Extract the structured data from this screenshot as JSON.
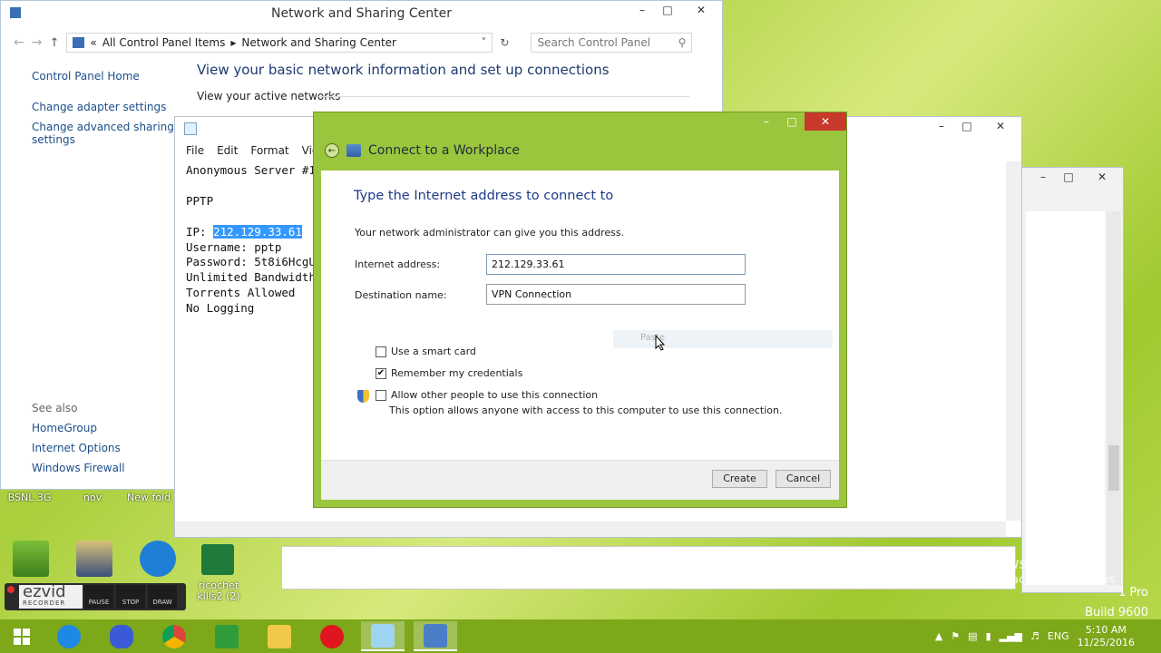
{
  "nsc": {
    "title": "Network and Sharing Center",
    "breadcrumb_root": "All Control Panel Items",
    "breadcrumb_current": "Network and Sharing Center",
    "search_placeholder": "Search Control Panel",
    "side": [
      "Control Panel Home",
      "Change adapter settings",
      "Change advanced sharing settings"
    ],
    "see_also_label": "See also",
    "see_also": [
      "HomeGroup",
      "Internet Options",
      "Windows Firewall"
    ],
    "heading": "View your basic network information and set up connections",
    "subheading": "View your active networks"
  },
  "notepad": {
    "menu": [
      "File",
      "Edit",
      "Format",
      "View"
    ],
    "lines": [
      "Anonymous Server #1",
      "",
      "PPTP",
      "",
      "IP: ",
      "Username: pptp",
      "Password: 5t8i6HcgU",
      "Unlimited Bandwidth",
      "Torrents Allowed",
      "No Logging"
    ],
    "selected_ip": "212.129.33.61"
  },
  "dialog": {
    "title": "Connect to a Workplace",
    "heading": "Type the Internet address to connect to",
    "hint": "Your network administrator can give you this address.",
    "internet_address_label": "Internet address:",
    "internet_address_value": "212.129.33.61",
    "destination_label": "Destination name:",
    "destination_value": "VPN Connection",
    "paste_label": "Paste",
    "smart_card_label": "Use a smart card",
    "remember_label": "Remember my credentials",
    "allow_label": "Allow other people to use this connection",
    "allow_note": "This option allows anyone with access to this computer to use this connection.",
    "smart_card_checked": false,
    "remember_checked": true,
    "allow_checked": false,
    "create_label": "Create",
    "cancel_label": "Cancel"
  },
  "desktop": {
    "partial_labels": [
      "BSNL 3G",
      "nov",
      "New fold"
    ],
    "ricochet_label": "ricochet kills2 (2)"
  },
  "ezvid": {
    "logo": "ezvid",
    "sub": "RECORDER",
    "tools": [
      "PAUSE",
      "STOP",
      "DRAW"
    ]
  },
  "watermark": {
    "line1": "Activate Windows",
    "line2": "Go to PC settings to activate Windows.",
    "edition_fragment": "1 Pro",
    "build": "Build 9600"
  },
  "taskbar": {
    "language": "ENG",
    "time": "5:10 AM",
    "date": "11/25/2016"
  },
  "colors": {
    "accent": "#9bc53d",
    "taskbar": "#7da81a",
    "close": "#c7392a",
    "link": "#1a4e8b"
  }
}
